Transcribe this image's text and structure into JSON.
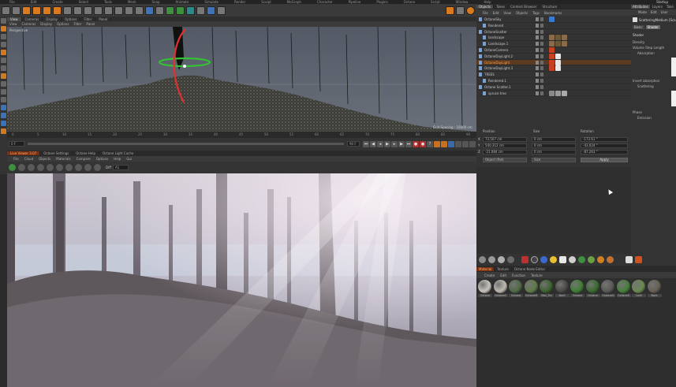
{
  "menu": [
    "File",
    "Edit",
    "Create",
    "Select",
    "Tools",
    "Mesh",
    "Snap",
    "Animate",
    "Simulate",
    "Render",
    "Sculpt",
    "MoGraph",
    "Character",
    "Pipeline",
    "Plugins",
    "Octane",
    "Script",
    "Window",
    "Help"
  ],
  "layout_label": "Startup",
  "viewport": {
    "tabs": [
      "View",
      "Cameras",
      "Display",
      "Options",
      "Filter",
      "Panel"
    ],
    "menu": [
      "View",
      "Cameras",
      "Display",
      "Options",
      "Filter",
      "Panel"
    ],
    "name": "Perspective",
    "grid_spacing": "Grid Spacing : 10000 cm"
  },
  "timeline": {
    "ticks": [
      "0",
      "5",
      "10",
      "15",
      "20",
      "25",
      "30",
      "35",
      "40",
      "45",
      "50",
      "55",
      "60",
      "65",
      "70",
      "75",
      "80",
      "85",
      "90"
    ],
    "start_field": "0 F",
    "end_field": "90 F",
    "current_frame": "0 F"
  },
  "render_view": {
    "tabs": [
      "Live Viewer 3.07",
      "Octane Settings",
      "Octane Help",
      "Octane Light Cache"
    ],
    "menu": [
      "File",
      "Cloud",
      "Objects",
      "Materials",
      "Compare",
      "Options",
      "Help",
      "Gui"
    ],
    "channel": "Diff",
    "channel_value": "A1"
  },
  "object_manager": {
    "tabs": [
      "Objects",
      "Takes",
      "Content Browser",
      "Structure"
    ],
    "menu": [
      "File",
      "Edit",
      "View",
      "Objects",
      "Tags",
      "Bookmarks"
    ],
    "objects": [
      {
        "name": "OctaneSky",
        "indent": 0,
        "highlight": false,
        "tag_colors": [
          "#3a7ad0"
        ]
      },
      {
        "name": "Rendered",
        "indent": 1,
        "highlight": false,
        "tag_colors": []
      },
      {
        "name": "OctaneScatter",
        "indent": 0,
        "highlight": false,
        "tag_colors": []
      },
      {
        "name": "landscape",
        "indent": 1,
        "highlight": false,
        "tag_colors": [
          "#8a6a4a",
          "#6a5a3a",
          "#8a6a4a"
        ]
      },
      {
        "name": "Landscape.1",
        "indent": 1,
        "highlight": false,
        "tag_colors": [
          "#8a6a4a",
          "#6a5a3a",
          "#8a6a4a"
        ]
      },
      {
        "name": "OctaneCamera",
        "indent": 0,
        "highlight": false,
        "tag_colors": [
          "#c84020"
        ]
      },
      {
        "name": "OctaneDayLight.2",
        "indent": 0,
        "highlight": false,
        "tag_colors": [
          "#c84020",
          "#e8e8e8"
        ]
      },
      {
        "name": "OctaneDayLight",
        "indent": 0,
        "highlight": true,
        "tag_colors": [
          "#c84020",
          "#e8e8e8"
        ]
      },
      {
        "name": "OctaneDayLight.3",
        "indent": 0,
        "highlight": false,
        "tag_colors": [
          "#c84020",
          "#e8e8e8"
        ]
      },
      {
        "name": "TREES",
        "indent": 0,
        "highlight": false,
        "tag_colors": []
      },
      {
        "name": "Rendered.1",
        "indent": 1,
        "highlight": false,
        "tag_colors": []
      },
      {
        "name": "Octane Scatter.1",
        "indent": 0,
        "highlight": false,
        "tag_colors": []
      },
      {
        "name": "spruce tree",
        "indent": 1,
        "highlight": false,
        "tag_colors": [
          "#888888",
          "#999999",
          "#aaaaaa"
        ]
      }
    ]
  },
  "coordinates": {
    "headers": [
      "Position",
      "Size",
      "Rotation"
    ],
    "rows": [
      {
        "axis": "X",
        "pos": "73.507 cm",
        "size": "0 cm",
        "rot": "-173.61 °"
      },
      {
        "axis": "Y",
        "pos": "540.312 cm",
        "size": "0 cm",
        "rot": "-43.024 °"
      },
      {
        "axis": "Z",
        "pos": "-21.084 cm",
        "size": "0 cm",
        "rot": "-87.263 °"
      }
    ],
    "mode": "Object (Rel)",
    "size_mode": "Size",
    "apply": "Apply"
  },
  "attributes": {
    "tabs": [
      "Attributes",
      "Layers",
      "Take"
    ],
    "menu": [
      "Mode",
      "Edit",
      "User"
    ],
    "title": "ScatteringMedium [Sca",
    "subtabs": [
      "Basic",
      "Shader"
    ],
    "section": "Shader",
    "rows": [
      "Density",
      "Volume Step Length",
      "Absorption",
      "Invert absorption",
      "Scattering",
      "Phase",
      "Emission"
    ]
  },
  "materials": {
    "tabs": [
      "Material",
      "Texture",
      "Octane Node Editor"
    ],
    "menu": [
      "Create",
      "Edit",
      "Function",
      "Texture"
    ],
    "items": [
      {
        "label": "Octane",
        "color": "#c9c5bd"
      },
      {
        "label": "OctaneG",
        "color": "#bdb9b0"
      },
      {
        "label": "Octane",
        "color": "#4f6a44"
      },
      {
        "label": "OctaneM",
        "color": "#5f7a48"
      },
      {
        "label": "Mat_Tre",
        "color": "#3d6330"
      },
      {
        "label": "Bark",
        "color": "#4a4844"
      },
      {
        "label": "Octane",
        "color": "#3f7f33"
      },
      {
        "label": "Octane",
        "color": "#3a6a30"
      },
      {
        "label": "OctaneG",
        "color": "#5a5a58"
      },
      {
        "label": "OctaneS",
        "color": "#46803a"
      },
      {
        "label": "Leaf",
        "color": "#6a8a50"
      },
      {
        "label": "Bark",
        "color": "#666055"
      }
    ]
  },
  "colors": {
    "accent": "#d97a1f",
    "highlight_row": "#5a3a20",
    "bg": "#2b2b2b"
  }
}
